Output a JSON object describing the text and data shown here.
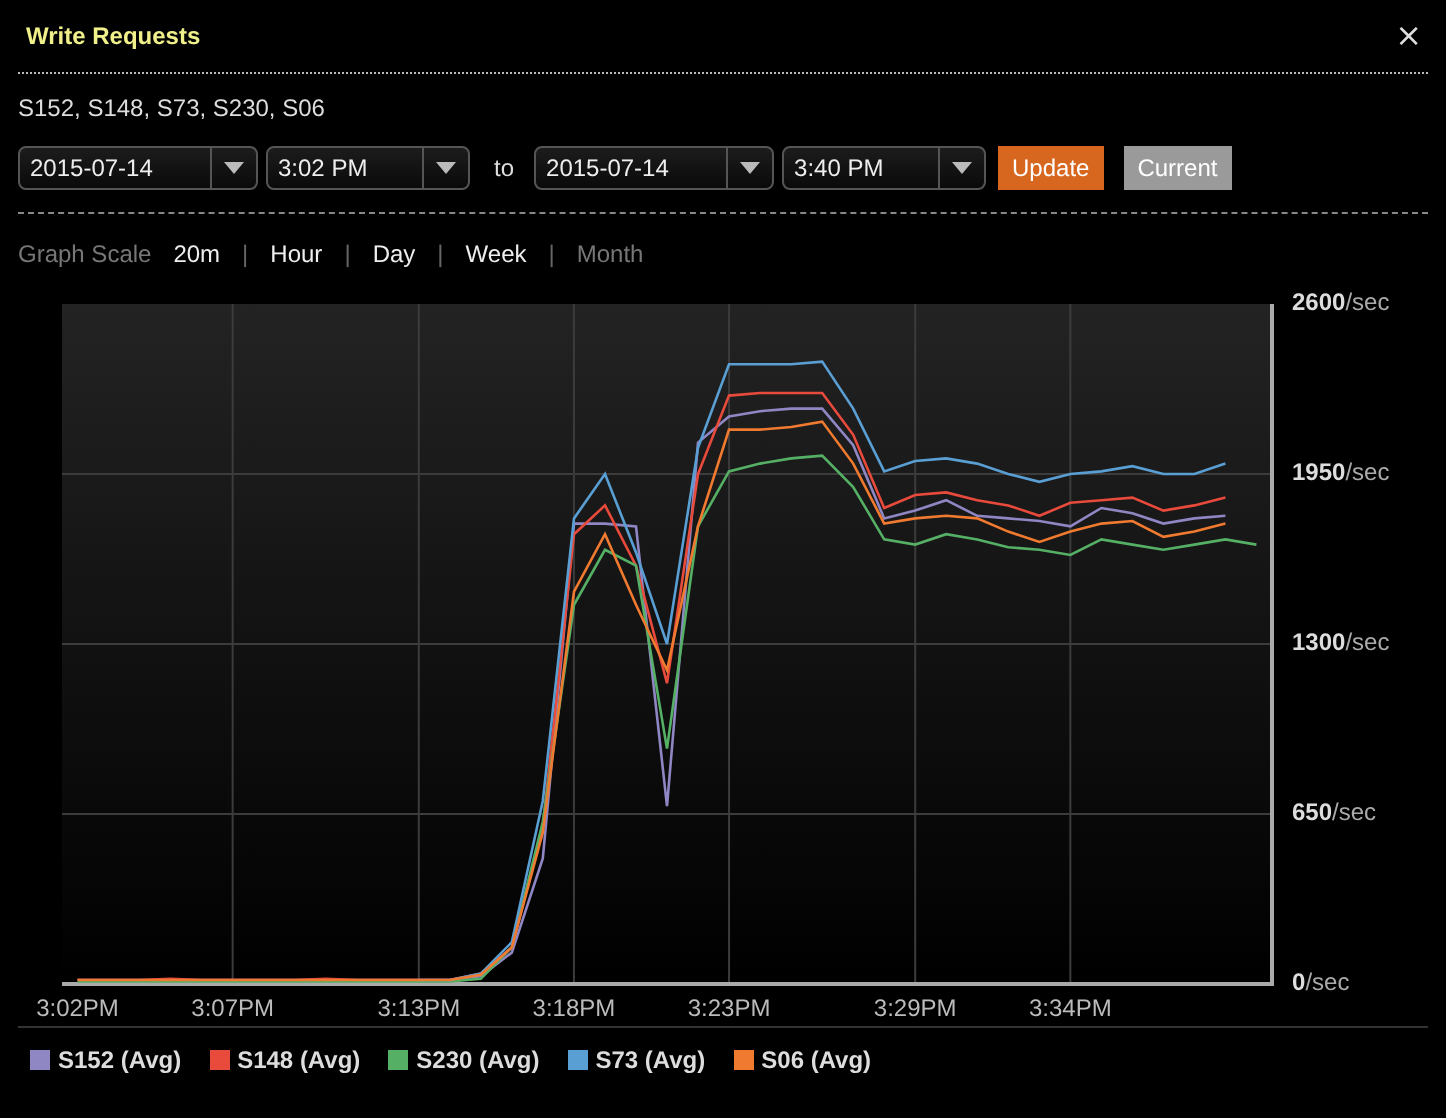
{
  "dialog": {
    "title": "Write Requests",
    "close": "×"
  },
  "servers": "S152, S148, S73, S230, S06",
  "range": {
    "from_date": "2015-07-14",
    "from_time": "3:02 PM",
    "to_label": "to",
    "to_date": "2015-07-14",
    "to_time": "3:40 PM",
    "buttons": [
      {
        "label": "Update",
        "kind": "primary"
      },
      {
        "label": "Current",
        "kind": "secondary"
      }
    ]
  },
  "graph_scale": {
    "label": "Graph Scale",
    "separator": "|",
    "options": [
      {
        "label": "20m",
        "disabled": false
      },
      {
        "label": "Hour",
        "disabled": false
      },
      {
        "label": "Day",
        "disabled": false
      },
      {
        "label": "Week",
        "disabled": false
      },
      {
        "label": "Month",
        "disabled": true
      }
    ]
  },
  "chart_data": {
    "type": "line",
    "categories": [
      "3:02PM",
      null,
      null,
      null,
      null,
      "3:07PM",
      null,
      null,
      null,
      null,
      null,
      "3:13PM",
      null,
      null,
      null,
      null,
      "3:18PM",
      null,
      null,
      null,
      null,
      "3:23PM",
      null,
      null,
      null,
      null,
      null,
      "3:29PM",
      null,
      null,
      null,
      null,
      "3:34PM",
      null,
      null,
      null,
      null,
      null,
      null
    ],
    "ylim": [
      0,
      2600
    ],
    "grid": true,
    "yticks": [
      {
        "value": 0,
        "label": "**0**/sec"
      },
      {
        "value": 650,
        "label": "**650**/sec"
      },
      {
        "value": 1300,
        "label": "**1300**/sec"
      },
      {
        "value": 1950,
        "label": "**1950**/sec"
      },
      {
        "value": 2600,
        "label": "**2600**/sec"
      }
    ],
    "series": [
      {
        "name": "S152 (Avg)",
        "color": "#8f86c4",
        "values": [
          15,
          15,
          15,
          15,
          15,
          15,
          15,
          15,
          15,
          15,
          15,
          15,
          15,
          30,
          120,
          480,
          1760,
          1760,
          1750,
          680,
          2070,
          2170,
          2190,
          2200,
          2200,
          2060,
          1780,
          1810,
          1850,
          1790,
          1780,
          1770,
          1750,
          1820,
          1800,
          1760,
          1780,
          1790,
          null
        ]
      },
      {
        "name": "S148 (Avg)",
        "color": "#e84a3c",
        "values": [
          15,
          15,
          15,
          20,
          15,
          15,
          15,
          15,
          20,
          15,
          15,
          15,
          15,
          40,
          140,
          600,
          1720,
          1830,
          1600,
          1150,
          1950,
          2250,
          2260,
          2260,
          2260,
          2100,
          1820,
          1870,
          1880,
          1850,
          1830,
          1790,
          1840,
          1850,
          1860,
          1810,
          1830,
          1860,
          null
        ]
      },
      {
        "name": "S230 (Avg)",
        "color": "#55b065",
        "values": [
          10,
          10,
          10,
          10,
          10,
          10,
          10,
          10,
          10,
          10,
          10,
          10,
          10,
          20,
          140,
          620,
          1450,
          1660,
          1600,
          900,
          1750,
          1960,
          1990,
          2010,
          2020,
          1900,
          1700,
          1680,
          1720,
          1700,
          1670,
          1660,
          1640,
          1700,
          1680,
          1660,
          1680,
          1700,
          1680
        ]
      },
      {
        "name": "S73 (Avg)",
        "color": "#5a9fd4",
        "values": [
          null,
          null,
          null,
          null,
          null,
          null,
          null,
          null,
          null,
          null,
          null,
          15,
          15,
          40,
          160,
          700,
          1780,
          1950,
          1650,
          1300,
          2050,
          2370,
          2370,
          2370,
          2380,
          2200,
          1960,
          2000,
          2010,
          1990,
          1950,
          1920,
          1950,
          1960,
          1980,
          1950,
          1950,
          1990,
          null
        ]
      },
      {
        "name": "S06 (Avg)",
        "color": "#f07a30",
        "values": [
          15,
          15,
          15,
          15,
          15,
          15,
          15,
          15,
          15,
          15,
          15,
          15,
          15,
          35,
          140,
          580,
          1500,
          1720,
          1450,
          1200,
          1750,
          2120,
          2120,
          2130,
          2150,
          1990,
          1760,
          1780,
          1790,
          1780,
          1730,
          1690,
          1730,
          1760,
          1770,
          1710,
          1730,
          1760,
          null
        ]
      }
    ]
  }
}
